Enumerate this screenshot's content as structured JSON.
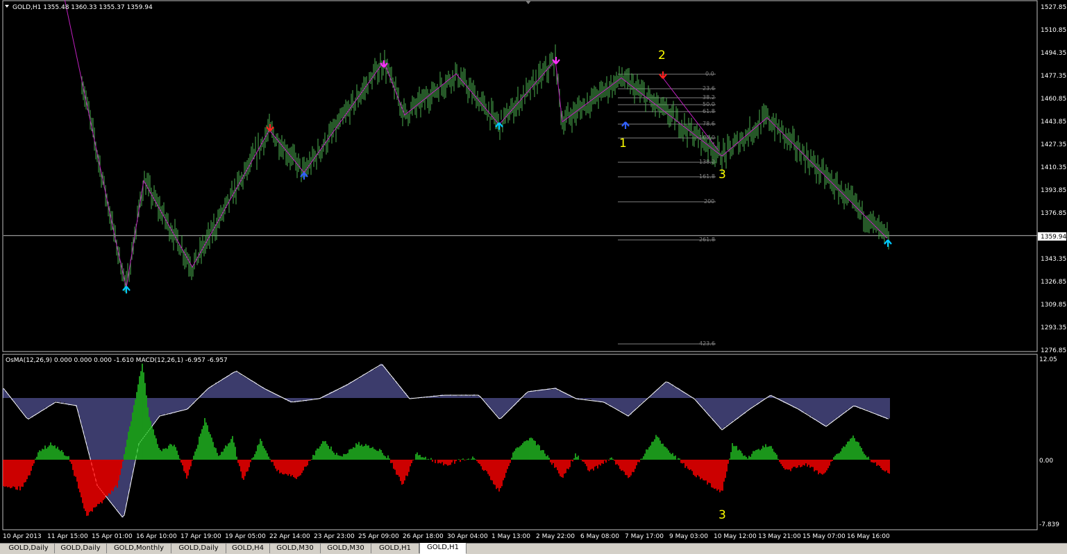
{
  "main_panel": {
    "header": "GOLD,H1  1355.48 1360.33 1355.37 1359.94",
    "price_ticks": [
      "1527.85",
      "1510.85",
      "1494.35",
      "1477.35",
      "1460.85",
      "1443.85",
      "1427.35",
      "1410.35",
      "1393.85",
      "1376.85",
      "1359.94",
      "1343.35",
      "1326.85",
      "1309.85",
      "1293.35",
      "1276.85"
    ],
    "current_price": "1359.94",
    "fib_levels": [
      "0.0",
      "23.6",
      "38.2",
      "50.0",
      "61.8",
      "78.6",
      "100.0",
      "138.2",
      "161.8",
      "200",
      "261.8",
      "423.6"
    ],
    "wave_labels": [
      "1",
      "2",
      "3"
    ]
  },
  "indicator_panel": {
    "header": "OsMA(12,26,9) 0.000 0.000 0.000 -1.610  MACD(12,26,1) -6.957 -6.957",
    "ticks": [
      "12.05",
      "0.00",
      "-7.839"
    ],
    "wave_label": "3"
  },
  "time_axis": [
    "10 Apr 2013",
    "11 Apr 15:00",
    "15 Apr 01:00",
    "16 Apr 10:00",
    "17 Apr 19:00",
    "19 Apr 05:00",
    "22 Apr 14:00",
    "23 Apr 23:00",
    "25 Apr 09:00",
    "26 Apr 18:00",
    "30 Apr 04:00",
    "1 May 13:00",
    "2 May 22:00",
    "6 May 08:00",
    "7 May 17:00",
    "9 May 03:00",
    "10 May 12:00",
    "13 May 21:00",
    "15 May 07:00",
    "16 May 16:00"
  ],
  "tabs": [
    "GOLD,Daily",
    "GOLD,Daily",
    "GOLD,Monthly",
    "GOLD,Daily",
    "GOLD,H4",
    "GOLD,M30",
    "GOLD,M30",
    "GOLD,H1",
    "GOLD,H1"
  ],
  "active_tab_index": 8,
  "colors": {
    "bars": "#4caf50",
    "zigzag": "#c020c0",
    "osma_up": "#22bb22",
    "osma_down": "#ff0000",
    "macd": "#7878d8",
    "wave_label": "#ffff00",
    "fib": "#808080",
    "arrow_cyan": "#00c8ff",
    "arrow_blue": "#3060ff",
    "arrow_red": "#ff2020",
    "arrow_magenta": "#ff30ff"
  },
  "chart_data": {
    "type": "line",
    "title": "GOLD,H1",
    "price_range": [
      1276.85,
      1527.85
    ],
    "zigzag_prices": [
      1535,
      1353,
      1322,
      1400,
      1337,
      1437,
      1406,
      1487,
      1448,
      1478,
      1441,
      1488,
      1443,
      1475,
      1418,
      1446,
      1358
    ],
    "osma_range": [
      -7.839,
      12.05
    ]
  }
}
